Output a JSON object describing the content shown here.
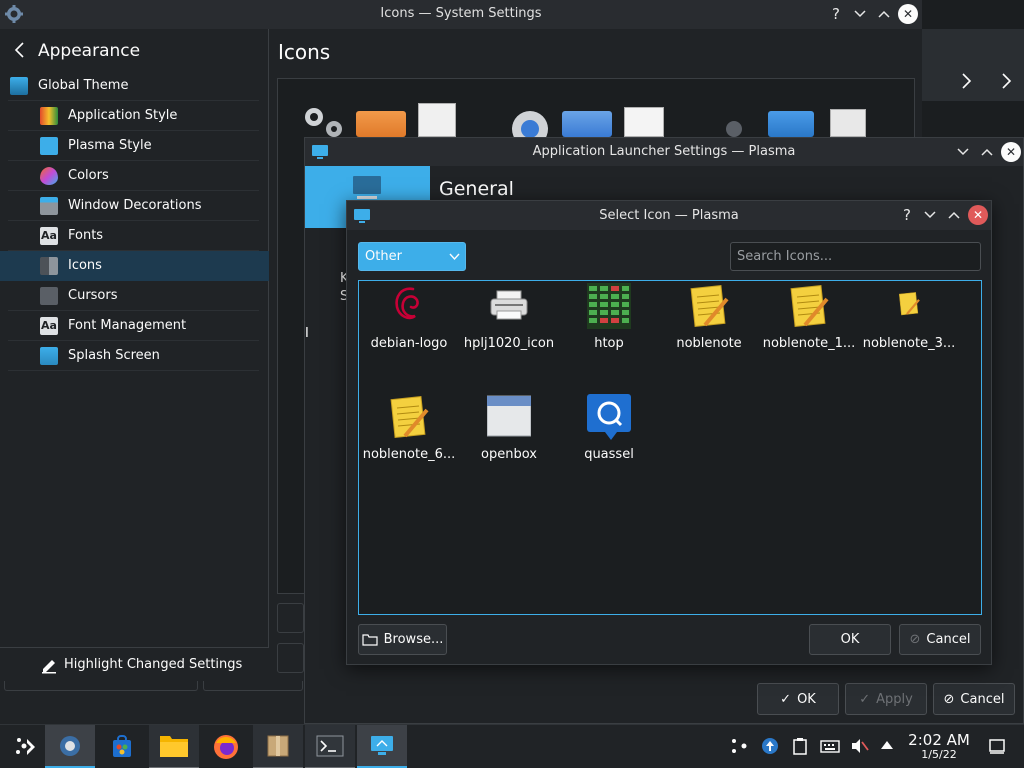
{
  "main_window": {
    "title": "Icons — System Settings",
    "sidebar": {
      "header": "Appearance",
      "items": [
        {
          "label": "Global Theme",
          "icon": "global-theme-icon"
        },
        {
          "label": "Application Style",
          "icon": "application-style-icon"
        },
        {
          "label": "Plasma Style",
          "icon": "plasma-style-icon"
        },
        {
          "label": "Colors",
          "icon": "colors-icon"
        },
        {
          "label": "Window Decorations",
          "icon": "window-decorations-icon"
        },
        {
          "label": "Fonts",
          "icon": "fonts-icon"
        },
        {
          "label": "Icons",
          "icon": "icons-icon",
          "selected": true
        },
        {
          "label": "Cursors",
          "icon": "cursors-icon"
        },
        {
          "label": "Font Management",
          "icon": "font-management-icon"
        },
        {
          "label": "Splash Screen",
          "icon": "splash-screen-icon"
        }
      ],
      "footer": "Highlight Changed Settings"
    },
    "content_title": "Icons",
    "buttons": {
      "ok": "OK",
      "apply": "Apply",
      "cancel": "Cancel"
    }
  },
  "launcher_window": {
    "title": "Application Launcher Settings — Plasma",
    "page_title": "General",
    "partial_label_1": "K",
    "partial_label_2": "S",
    "partial_label_3": "I"
  },
  "icon_dialog": {
    "title": "Select Icon — Plasma",
    "category": "Other",
    "search_placeholder": "Search Icons...",
    "icons": [
      {
        "name": "debian-logo",
        "icon": "debian-logo-icon"
      },
      {
        "name": "hplj1020_icon",
        "icon": "printer-icon"
      },
      {
        "name": "htop",
        "icon": "htop-icon"
      },
      {
        "name": "noblenote",
        "icon": "notepad-icon"
      },
      {
        "name": "noblenote_1...",
        "icon": "notepad-icon"
      },
      {
        "name": "noblenote_3...",
        "icon": "notepad-icon"
      },
      {
        "name": "noblenote_6...",
        "icon": "notepad-icon"
      },
      {
        "name": "openbox",
        "icon": "window-icon"
      },
      {
        "name": "quassel",
        "icon": "quassel-icon"
      }
    ],
    "browse_label": "Browse...",
    "ok_label": "OK",
    "cancel_label": "Cancel"
  },
  "taskbar": {
    "time": "2:02 AM",
    "date": "1/5/22"
  },
  "colors": {
    "accent": "#3daee9",
    "window_bg": "#202326",
    "titlebar_bg": "#292c30"
  }
}
